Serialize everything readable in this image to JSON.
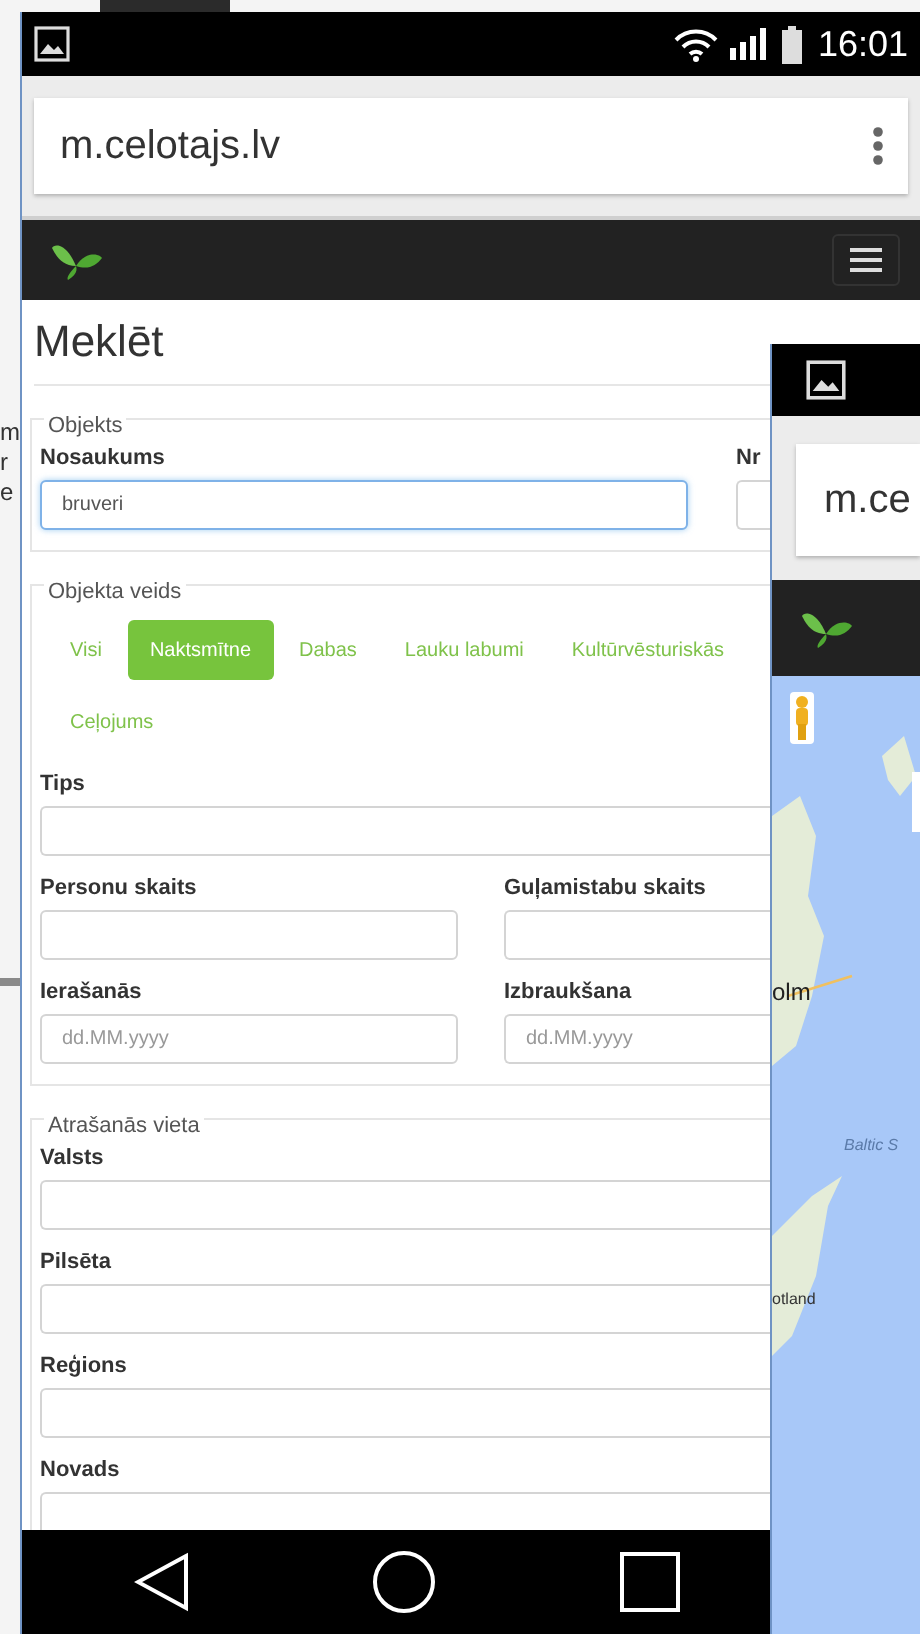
{
  "background": {
    "fragments": [
      "m",
      "r",
      "e"
    ]
  },
  "phone": {
    "status_bar": {
      "time": "16:01"
    },
    "browser": {
      "url": "m.celotajs.lv"
    },
    "page": {
      "title": "Meklēt",
      "fieldsets": [
        {
          "legend": "Objekts",
          "rows": [
            {
              "kind": "fields",
              "wide_first": true,
              "fields": [
                {
                  "label": "Nosaukums",
                  "value": "bruveri",
                  "focused": true
                },
                {
                  "label": "Nr",
                  "focused": false
                }
              ]
            }
          ]
        },
        {
          "legend": "Objekta veids",
          "rows": [
            {
              "kind": "chips",
              "options": [
                {
                  "label": "Visi",
                  "selected": false
                },
                {
                  "label": "Naktsmītne",
                  "selected": true
                },
                {
                  "label": "Dabas",
                  "selected": false
                },
                {
                  "label": "Lauku labumi",
                  "selected": false
                },
                {
                  "label": "Kultūrvēsturiskās",
                  "selected": false
                },
                {
                  "label": "Ceļojums",
                  "selected": false
                }
              ]
            },
            {
              "kind": "fields",
              "fields": [
                {
                  "label": "Tips",
                  "focused": false
                }
              ]
            },
            {
              "kind": "fields",
              "fields": [
                {
                  "label": "Personu skaits",
                  "focused": false
                },
                {
                  "label": "Guļamistabu skaits",
                  "focused": false
                }
              ]
            },
            {
              "kind": "fields",
              "fields": [
                {
                  "label": "Ierašanās",
                  "placeholder": "dd.MM.yyyy",
                  "focused": false
                },
                {
                  "label": "Izbraukšana",
                  "placeholder": "dd.MM.yyyy",
                  "focused": false
                }
              ]
            }
          ]
        },
        {
          "legend": "Atrašanās vieta",
          "rows": [
            {
              "kind": "fields",
              "fields": [
                {
                  "label": "Valsts",
                  "focused": false
                }
              ]
            },
            {
              "kind": "fields",
              "fields": [
                {
                  "label": "Pilsēta",
                  "focused": false
                }
              ]
            },
            {
              "kind": "fields",
              "fields": [
                {
                  "label": "Reģions",
                  "focused": false
                }
              ]
            },
            {
              "kind": "fields",
              "fields": [
                {
                  "label": "Novads",
                  "focused": false
                }
              ]
            }
          ]
        }
      ]
    }
  },
  "second_phone": {
    "browser": {
      "url": "m.ce"
    },
    "map_labels": [
      {
        "kind": "city",
        "text": "olm"
      },
      {
        "kind": "sea",
        "text": "Baltic S"
      },
      {
        "kind": "island",
        "text": "otland"
      }
    ]
  }
}
